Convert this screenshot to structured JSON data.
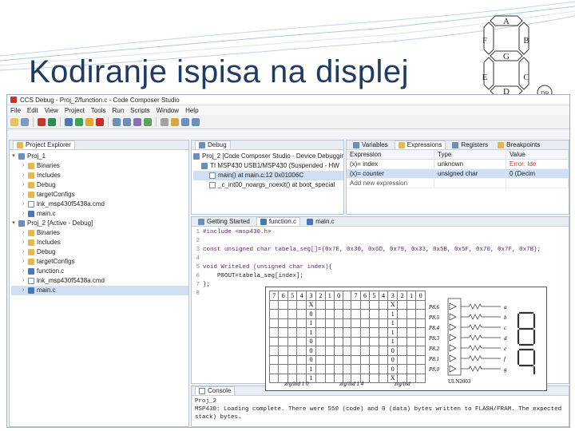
{
  "slide": {
    "title": "Kodiranje ispisa na displej"
  },
  "seven_segment": {
    "segments": [
      "A",
      "B",
      "C",
      "D",
      "E",
      "F",
      "G"
    ],
    "dp_label": "DP"
  },
  "ide": {
    "window_title": "CCS Debug - Proj_2/function.c - Code Composer Studio",
    "menu": [
      "File",
      "Edit",
      "View",
      "Project",
      "Tools",
      "Run",
      "Scripts",
      "Window",
      "Help"
    ],
    "project_explorer": {
      "tab": "Project Explorer",
      "items": [
        {
          "label": "Proj_1",
          "indent": 0,
          "kind": "proj",
          "arrow": "v",
          "selected": false
        },
        {
          "label": "Binaries",
          "indent": 1,
          "kind": "folder",
          "arrow": ">",
          "selected": false
        },
        {
          "label": "Includes",
          "indent": 1,
          "kind": "folder",
          "arrow": ">",
          "selected": false
        },
        {
          "label": "Debug",
          "indent": 1,
          "kind": "folder",
          "arrow": ">",
          "selected": false
        },
        {
          "label": "targetConfigs",
          "indent": 1,
          "kind": "folder",
          "arrow": ">",
          "selected": false
        },
        {
          "label": "lnk_msp430f5438a.cmd",
          "indent": 1,
          "kind": "file",
          "arrow": ">",
          "selected": false
        },
        {
          "label": "main.c",
          "indent": 1,
          "kind": "cfile",
          "arrow": ">",
          "selected": false
        },
        {
          "label": "Proj_2 [Active - Debug]",
          "indent": 0,
          "kind": "proj",
          "arrow": "v",
          "selected": false
        },
        {
          "label": "Binaries",
          "indent": 1,
          "kind": "folder",
          "arrow": ">",
          "selected": false
        },
        {
          "label": "Includes",
          "indent": 1,
          "kind": "folder",
          "arrow": ">",
          "selected": false
        },
        {
          "label": "Debug",
          "indent": 1,
          "kind": "folder",
          "arrow": ">",
          "selected": false
        },
        {
          "label": "targetConfigs",
          "indent": 1,
          "kind": "folder",
          "arrow": ">",
          "selected": false
        },
        {
          "label": "function.c",
          "indent": 1,
          "kind": "cfile",
          "arrow": ">",
          "selected": false
        },
        {
          "label": "lnk_msp430f5438a.cmd",
          "indent": 1,
          "kind": "file",
          "arrow": ">",
          "selected": false
        },
        {
          "label": "main.c",
          "indent": 1,
          "kind": "cfile",
          "arrow": ">",
          "selected": true
        }
      ]
    },
    "debug": {
      "tab": "Debug",
      "items": [
        {
          "label": "Proj_2 [Code Composer Studio - Device Debugging]",
          "indent": 0,
          "selected": false
        },
        {
          "label": "TI MSP430 USB1/MSP430 (Suspended - HW",
          "indent": 1,
          "selected": false
        },
        {
          "label": "main() at main.c:12 0x01006C",
          "indent": 2,
          "selected": true
        },
        {
          "label": "_c_int00_noargs_noexit() at boot_special",
          "indent": 2,
          "selected": false
        }
      ]
    },
    "variables": {
      "tabs": [
        "Variables",
        "Expressions",
        "Registers",
        "Breakpoints"
      ],
      "columns": [
        "Expression",
        "Type",
        "Value"
      ],
      "rows": [
        {
          "expr": "(x)= index",
          "type": "unknown",
          "value": "Error: Ide",
          "selected": false
        },
        {
          "expr": "(x)= counter",
          "type": "unsigned char",
          "value": "0 (Decim",
          "selected": true
        },
        {
          "expr": "Add new expression",
          "type": "",
          "value": "",
          "selected": false
        }
      ]
    },
    "editor": {
      "tabs": [
        "Getting Started",
        "function.c",
        "main.c"
      ],
      "active_tab": "function.c",
      "lines": [
        {
          "n": "1",
          "text": "#include <msp430.h>"
        },
        {
          "n": "2",
          "text": ""
        },
        {
          "n": "3",
          "text": "const unsigned char tabela_seg[]={0x7E, 0x30, 0x6D, 0x79, 0x33, 0x5B, 0x5F, 0x70, 0x7F, 0x7B};"
        },
        {
          "n": "4",
          "text": ""
        },
        {
          "n": "5",
          "text": "void WriteLed (unsigned char index){"
        },
        {
          "n": "6",
          "text": "    P8OUT=tabela_seg[index];"
        },
        {
          "n": "7",
          "text": "};"
        },
        {
          "n": "8",
          "text": ""
        }
      ]
    },
    "truth_table": {
      "header": [
        "7",
        "6",
        "5",
        "4",
        "3",
        "2",
        "1",
        "0",
        "",
        "7",
        "6",
        "5",
        "4",
        "3",
        "2",
        "1",
        "0"
      ],
      "rows": [
        [
          "",
          "",
          "",
          "",
          "X",
          "",
          "",
          "",
          "",
          "",
          "",
          "",
          "",
          "X",
          "",
          "",
          ""
        ],
        [
          "",
          "",
          "",
          "",
          "0",
          "",
          "",
          "",
          "",
          "",
          "",
          "",
          "",
          "1",
          "",
          "",
          ""
        ],
        [
          "",
          "",
          "",
          "",
          "1",
          "",
          "",
          "",
          "",
          "",
          "",
          "",
          "",
          "1",
          "",
          "",
          ""
        ],
        [
          "",
          "",
          "",
          "",
          "1",
          "",
          "",
          "",
          "",
          "",
          "",
          "",
          "",
          "1",
          "",
          "",
          ""
        ],
        [
          "",
          "",
          "",
          "",
          "0",
          "",
          "",
          "",
          "",
          "",
          "",
          "",
          "",
          "1",
          "",
          "",
          ""
        ],
        [
          "",
          "",
          "",
          "",
          "0",
          "",
          "",
          "",
          "",
          "",
          "",
          "",
          "",
          "0",
          "",
          "",
          ""
        ],
        [
          "",
          "",
          "",
          "",
          "0",
          "",
          "",
          "",
          "",
          "",
          "",
          "",
          "",
          "0",
          "",
          "",
          ""
        ],
        [
          "",
          "",
          "",
          "",
          "1",
          "",
          "",
          "",
          "",
          "",
          "",
          "",
          "",
          "0",
          "",
          "",
          ""
        ],
        [
          "",
          "",
          "",
          "",
          "1",
          "",
          "",
          "",
          "",
          "",
          "",
          "",
          "",
          "X",
          "",
          "",
          ""
        ]
      ],
      "footer": [
        "zrg/ind 1 0",
        "zrg/ind 1 4",
        "zrg/ind"
      ],
      "pins": [
        "P8.6",
        "P8.5",
        "P8.4",
        "P8.3",
        "P8.2",
        "P8.1",
        "P8.0"
      ],
      "seg_letters": [
        "a",
        "b",
        "c",
        "d",
        "e",
        "f",
        "g"
      ],
      "driver": "ULN2003"
    },
    "console": {
      "tab": "Console",
      "lines": [
        "Proj_2",
        "MSP430: Loading complete. There were 550 (code) and 0 (data) bytes written to FLASH/FRAM. The expected",
        "stack) bytes."
      ]
    },
    "colors": {
      "title": "#1f3b63",
      "frame": "#9ab0c8",
      "selection": "#cfe0f5"
    }
  }
}
